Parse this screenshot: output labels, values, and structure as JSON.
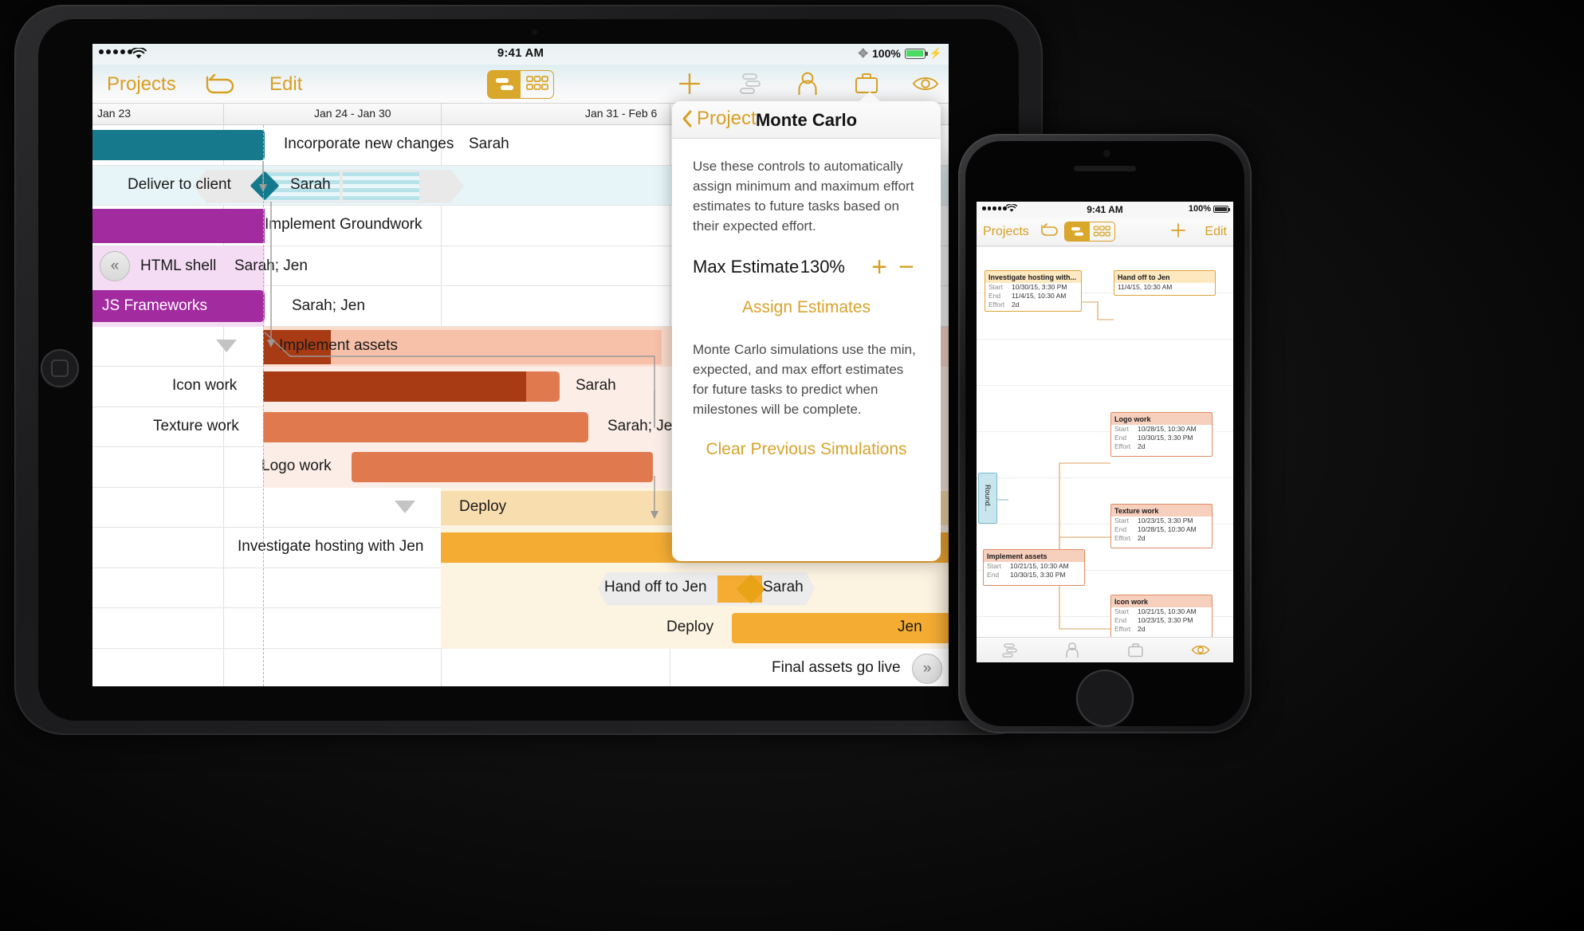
{
  "ipad": {
    "status": {
      "signal_dots": 5,
      "wifi_icon": "wifi-icon",
      "time": "9:41 AM",
      "bluetooth_icon": "bluetooth-icon",
      "battery_percent": "100%",
      "battery_icon": "battery-full-icon",
      "charging_icon": "lightning-bolt-icon"
    },
    "nav": {
      "projects": "Projects",
      "undo_icon": "undo-arrow-icon",
      "edit": "Edit",
      "segmented": [
        {
          "name": "outline-view",
          "selected": true
        },
        {
          "name": "network-view",
          "selected": false
        }
      ],
      "toolbar_icons": [
        "plus-icon",
        "gantt-chart-icon",
        "person-icon",
        "briefcase-icon",
        "eye-icon"
      ]
    },
    "timeline_header": [
      "Jan 23",
      "Jan 24 - Jan 30",
      "Jan 31 - Feb 6"
    ],
    "rows": [
      {
        "label": "Incorporate new changes",
        "assignee": "Sarah",
        "kind": "bar",
        "color": "#17798c"
      },
      {
        "label": "Deliver to client",
        "assignee": "Sarah",
        "kind": "milestone",
        "color": "#13798c"
      },
      {
        "label": "Implement Groundwork",
        "assignee": "",
        "kind": "group",
        "color": "#a32ba0"
      },
      {
        "label": "HTML shell",
        "assignee": "Sarah; Jen",
        "kind": "bar",
        "color": "#f2d8f2"
      },
      {
        "label": "JS Frameworks",
        "assignee": "Sarah; Jen",
        "kind": "bar",
        "color": "#a32ba0"
      },
      {
        "label": "Implement assets",
        "assignee": "",
        "kind": "group",
        "color": "#a83a14"
      },
      {
        "label": "Icon work",
        "assignee": "Sarah",
        "kind": "bar",
        "color": "#a83a14"
      },
      {
        "label": "Texture work",
        "assignee": "Sarah; Jen",
        "kind": "bar",
        "color": "#e07a4e"
      },
      {
        "label": "Logo work",
        "assignee": "",
        "kind": "bar",
        "color": "#e07a4e"
      },
      {
        "label": "Deploy",
        "assignee": "",
        "kind": "group",
        "color": "#f6d79a"
      },
      {
        "label": "Investigate hosting with Jen",
        "assignee": "",
        "kind": "bar",
        "color": "#f5ac33"
      },
      {
        "label": "Hand off to Jen",
        "assignee": "Sarah",
        "kind": "milestone",
        "color": "#e8a317"
      },
      {
        "label": "Deploy",
        "assignee": "Jen",
        "kind": "bar",
        "color": "#f5ac33"
      },
      {
        "label": "Final assets go live",
        "assignee": "",
        "kind": "milestone-end",
        "color": "#f5ac33"
      }
    ],
    "collapse_icon": "double-chevron-left-icon",
    "expand_icon": "double-chevron-right-icon"
  },
  "popover": {
    "back_label": "Project",
    "back_icon": "chevron-left-icon",
    "title": "Monte Carlo",
    "description": "Use these controls to automatically assign minimum and maximum effort estimates to future tasks based on their expected effort.",
    "setting_label": "Max Estimate",
    "setting_value": "130%",
    "increment_icon": "plus-icon",
    "decrement_icon": "minus-icon",
    "assign_button": "Assign Estimates",
    "note": "Monte Carlo simulations use the min, expected, and max effort estimates for future tasks to predict when milestones will be complete.",
    "clear_button": "Clear Previous Simulations",
    "accent": "#d79f24"
  },
  "iphone": {
    "status": {
      "signal_dots": 5,
      "wifi_icon": "wifi-icon",
      "time": "9:41 AM",
      "battery_percent": "100%",
      "battery_icon": "battery-full-icon"
    },
    "nav": {
      "projects": "Projects",
      "undo_icon": "undo-arrow-icon",
      "edit": "Edit",
      "plus_icon": "plus-icon",
      "segmented": [
        {
          "name": "outline-view",
          "selected": true
        },
        {
          "name": "network-view",
          "selected": false
        }
      ]
    },
    "notes": [
      {
        "title": "Investigate hosting with...",
        "style": "amber",
        "fields": [
          {
            "k": "Start",
            "v": "10/30/15, 3:30 PM"
          },
          {
            "k": "End",
            "v": "11/4/15, 10:30 AM"
          },
          {
            "k": "Effort",
            "v": "2d"
          }
        ]
      },
      {
        "title": "Hand off to Jen",
        "style": "amber",
        "fields": [
          {
            "k": "",
            "v": "11/4/15, 10:30 AM"
          }
        ]
      },
      {
        "title": "Logo work",
        "style": "sal",
        "fields": [
          {
            "k": "Start",
            "v": "10/28/15, 10:30 AM"
          },
          {
            "k": "End",
            "v": "10/30/15, 3:30 PM"
          },
          {
            "k": "Effort",
            "v": "2d"
          }
        ]
      },
      {
        "title": "Texture work",
        "style": "sal",
        "fields": [
          {
            "k": "Start",
            "v": "10/23/15, 3:30 PM"
          },
          {
            "k": "End",
            "v": "10/28/15, 10:30 AM"
          },
          {
            "k": "Effort",
            "v": "2d"
          }
        ]
      },
      {
        "title": "Implement assets",
        "style": "sal",
        "fields": [
          {
            "k": "Start",
            "v": "10/21/15, 10:30 AM"
          },
          {
            "k": "End",
            "v": "10/30/15, 3:30 PM"
          }
        ]
      },
      {
        "title": "Icon work",
        "style": "sal",
        "fields": [
          {
            "k": "Start",
            "v": "10/21/15, 10:30 AM"
          },
          {
            "k": "End",
            "v": "10/23/15, 3:30 PM"
          },
          {
            "k": "Effort",
            "v": "2d"
          }
        ]
      },
      {
        "title": "Round...",
        "style": "blue",
        "fields": []
      }
    ],
    "tabbar_icons": [
      "gantt-chart-icon",
      "person-icon",
      "briefcase-icon",
      "eye-icon"
    ]
  }
}
